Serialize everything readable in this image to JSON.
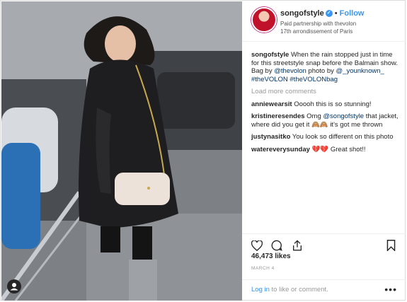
{
  "header": {
    "username": "songofstyle",
    "verified_icon": "✓",
    "separator": "•",
    "follow_label": "Follow",
    "subline1": "Paid partnership with thevolon",
    "subline2": "17th arrondissement of Paris"
  },
  "caption": {
    "user": "songofstyle",
    "text1": " When the rain stopped just in time for this streetstyle snap before the Balmain show. Bag by ",
    "mention1": "@thevolon",
    "text2": " photo by ",
    "mention2": "@_younknown_",
    "tag1": "#theVOLON",
    "tag2": "#theVOLONbag"
  },
  "load_more": "Load more comments",
  "comments": [
    {
      "user": "anniewearsit",
      "pre": " Ooooh this is so stunning!",
      "mention": "",
      "post": ""
    },
    {
      "user": "kristineresendes",
      "pre": " Omg ",
      "mention": "@songofstyle",
      "post": " that jacket, where did you get it 🙈🙈 it's got me thrown"
    },
    {
      "user": "justynasitko",
      "pre": " You look so different on this photo",
      "mention": "",
      "post": ""
    },
    {
      "user": "watereverysunday",
      "pre": " ",
      "mention": "",
      "post": " Great shot!!",
      "hearts": "💔💔"
    }
  ],
  "actions": {
    "like_icon": "heart-outline",
    "comment_icon": "comment-bubble",
    "share_icon": "share-arrow",
    "save_icon": "bookmark"
  },
  "likes": "46,473 likes",
  "date": "MARCH 4",
  "login": {
    "link": "Log in",
    "rest": " to like or comment."
  },
  "more_options": "•••",
  "colors": {
    "link_blue": "#3897f0",
    "mention": "#003569",
    "heart": "#ed4956"
  }
}
